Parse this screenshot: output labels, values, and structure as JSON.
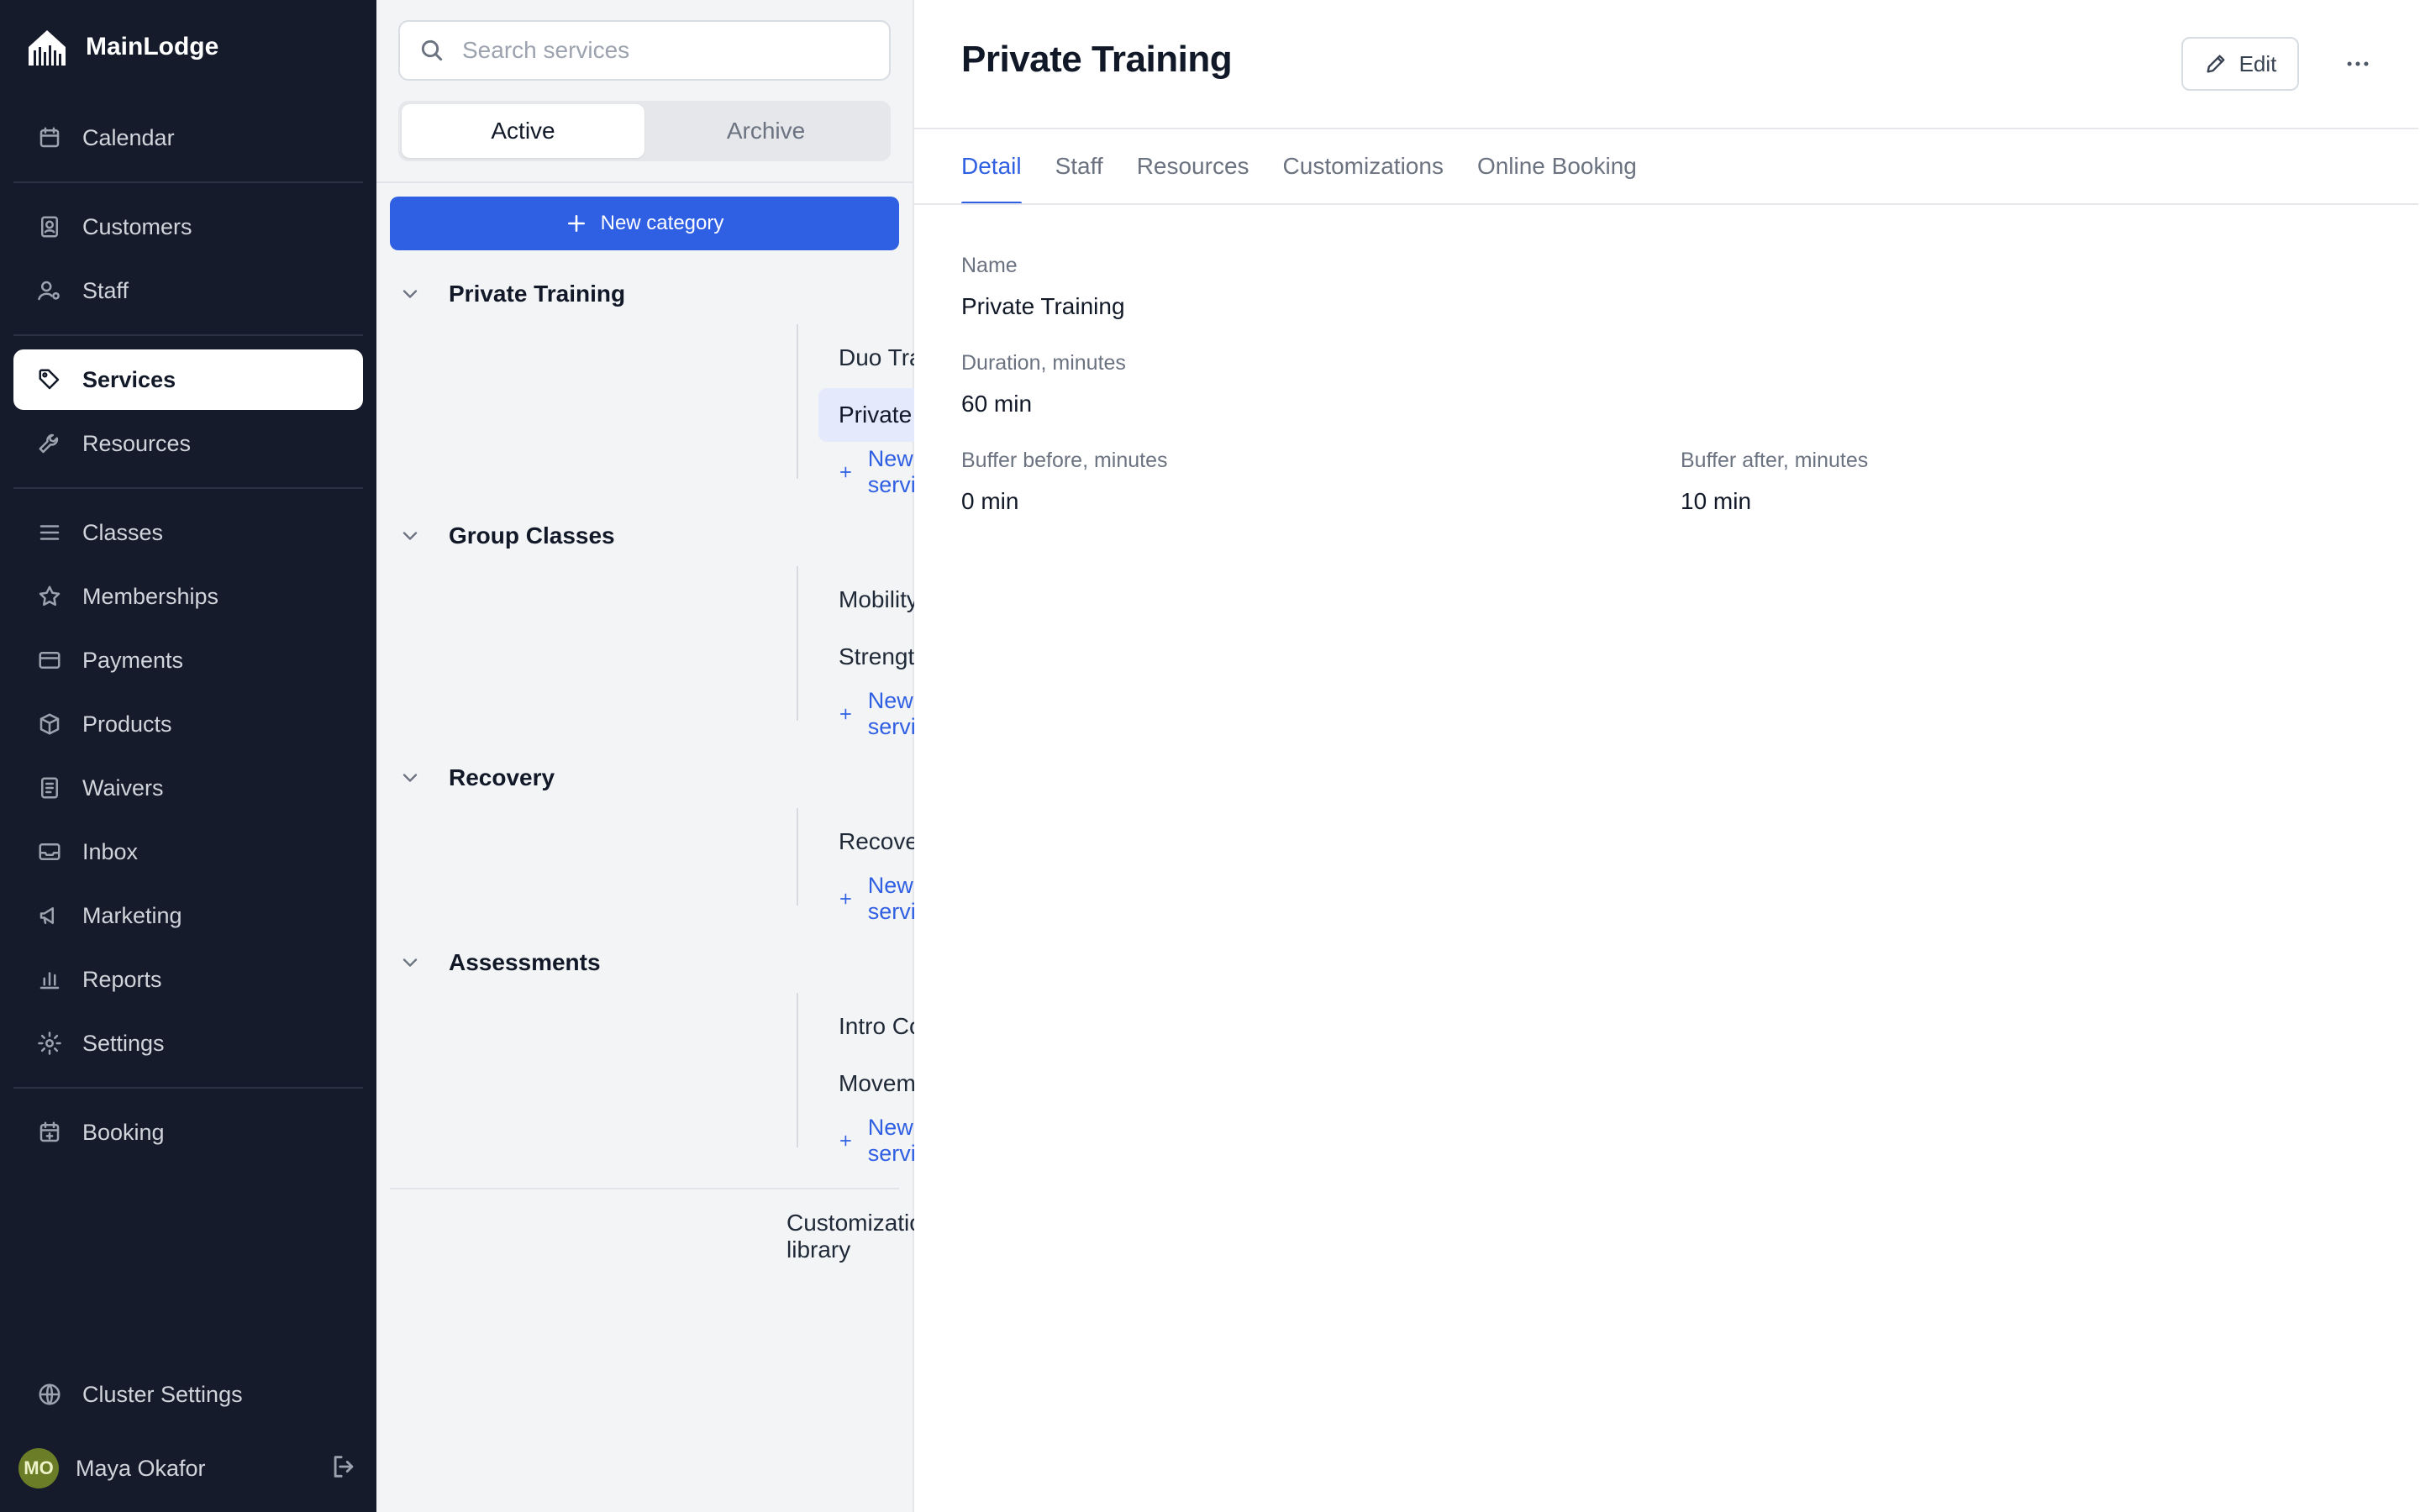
{
  "app": {
    "name": "MainLodge"
  },
  "nav": {
    "items": [
      {
        "label": "Calendar",
        "icon": "calendar-icon"
      },
      {
        "label": "Customers",
        "icon": "contact-card-icon"
      },
      {
        "label": "Staff",
        "icon": "staff-icon"
      },
      {
        "label": "Services",
        "icon": "tag-icon",
        "active": true
      },
      {
        "label": "Resources",
        "icon": "wrench-icon"
      },
      {
        "label": "Classes",
        "icon": "list-icon"
      },
      {
        "label": "Memberships",
        "icon": "star-icon"
      },
      {
        "label": "Payments",
        "icon": "credit-card-icon"
      },
      {
        "label": "Products",
        "icon": "box-icon"
      },
      {
        "label": "Waivers",
        "icon": "document-icon"
      },
      {
        "label": "Inbox",
        "icon": "inbox-icon"
      },
      {
        "label": "Marketing",
        "icon": "megaphone-icon"
      },
      {
        "label": "Reports",
        "icon": "bar-chart-icon"
      },
      {
        "label": "Settings",
        "icon": "gear-icon"
      },
      {
        "label": "Booking",
        "icon": "calendar-plus-icon"
      }
    ],
    "cluster_settings": "Cluster Settings",
    "user": {
      "initials": "MO",
      "name": "Maya Okafor"
    }
  },
  "services_panel": {
    "search_placeholder": "Search services",
    "segments": [
      "Active",
      "Archive"
    ],
    "active_segment": "Active",
    "new_category_label": "New category",
    "new_service_label": "New service",
    "categories": [
      {
        "name": "Private Training",
        "services": [
          "Duo Training",
          "Private Training"
        ]
      },
      {
        "name": "Group Classes",
        "services": [
          "Mobility Class",
          "Strength Class"
        ]
      },
      {
        "name": "Recovery",
        "services": [
          "Recovery Session"
        ]
      },
      {
        "name": "Assessments",
        "services": [
          "Intro Consultation",
          "Movement Assessment"
        ]
      }
    ],
    "selected_service": "Private Training",
    "customization_library": "Customization library"
  },
  "detail": {
    "title": "Private Training",
    "edit_label": "Edit",
    "tabs": [
      "Detail",
      "Staff",
      "Resources",
      "Customizations",
      "Online Booking"
    ],
    "active_tab": "Detail",
    "fields": {
      "name": {
        "label": "Name",
        "value": "Private Training"
      },
      "duration": {
        "label": "Duration, minutes",
        "value": "60 min"
      },
      "buffer_before": {
        "label": "Buffer before, minutes",
        "value": "0 min"
      },
      "buffer_after": {
        "label": "Buffer after, minutes",
        "value": "10 min"
      }
    }
  },
  "colors": {
    "sidebar_bg": "#151b2b",
    "accent": "#2f5fe3",
    "selected_row_bg": "#e4e9fb",
    "avatar_bg": "#6b7d27"
  }
}
